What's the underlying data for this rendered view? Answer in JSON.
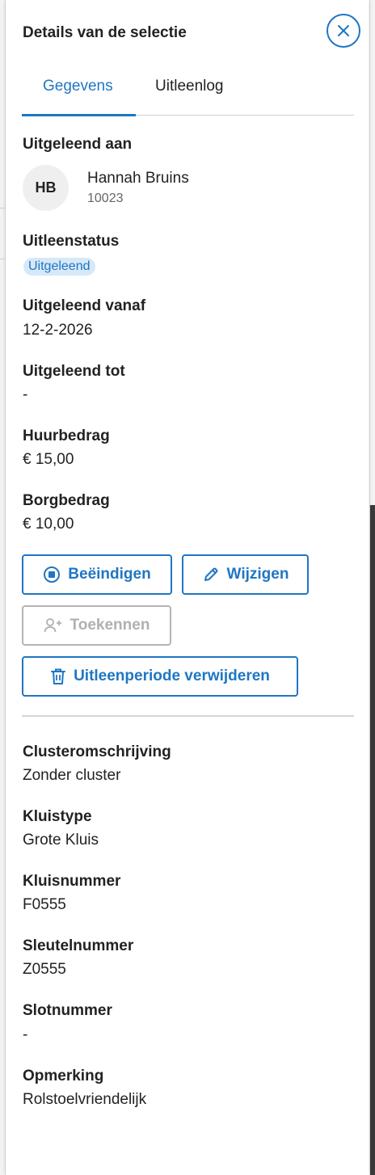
{
  "panel": {
    "title": "Details van de selectie",
    "close_icon": "close-circle-icon"
  },
  "tabs": [
    {
      "label": "Gegevens",
      "active": true
    },
    {
      "label": "Uitleenlog",
      "active": false
    }
  ],
  "loan": {
    "borrower_label": "Uitgeleend aan",
    "borrower_initials": "HB",
    "borrower_name": "Hannah Bruins",
    "borrower_id": "10023",
    "status_label": "Uitleenstatus",
    "status_value": "Uitgeleend",
    "from_label": "Uitgeleend vanaf",
    "from_value": "12-2-2026",
    "until_label": "Uitgeleend tot",
    "until_value": "-",
    "rent_label": "Huurbedrag",
    "rent_value": "€ 15,00",
    "deposit_label": "Borgbedrag",
    "deposit_value": "€ 10,00"
  },
  "actions": {
    "end_label": "Beëindigen",
    "edit_label": "Wijzigen",
    "assign_label": "Toekennen",
    "delete_label": "Uitleenperiode verwijderen"
  },
  "locker": {
    "cluster_label": "Clusteromschrijving",
    "cluster_value": "Zonder cluster",
    "type_label": "Kluistype",
    "type_value": "Grote Kluis",
    "number_label": "Kluisnummer",
    "number_value": "F0555",
    "key_label": "Sleutelnummer",
    "key_value": "Z0555",
    "lock_label": "Slotnummer",
    "lock_value": "-",
    "note_label": "Opmerking",
    "note_value": "Rolstoelvriendelijk"
  },
  "colors": {
    "accent": "#1f76c2",
    "badge_bg": "#d7e8f7",
    "disabled": "#b5b5b5"
  }
}
